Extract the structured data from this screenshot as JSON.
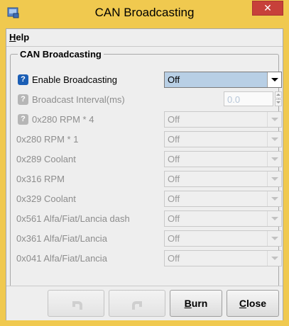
{
  "window": {
    "title": "CAN Broadcasting",
    "close_glyph": "✕",
    "app_icon": "app-icon",
    "accent_color": "#f0c94f",
    "close_color": "#c7403a"
  },
  "menu": {
    "help_mnemonic": "H",
    "help_rest": "elp"
  },
  "group": {
    "legend": "CAN Broadcasting"
  },
  "help_icon_glyph": "?",
  "settings": [
    {
      "label": "Enable Broadcasting",
      "value": "Off",
      "enabled": true,
      "help_icon": true
    },
    {
      "label": "Broadcast Interval(ms)",
      "value": "0.0",
      "enabled": false,
      "help_icon": true,
      "control": "spinner"
    },
    {
      "label": "0x280 RPM * 4",
      "value": "Off",
      "enabled": false,
      "help_icon": true
    },
    {
      "label": "0x280 RPM * 1",
      "value": "Off",
      "enabled": false,
      "help_icon": false
    },
    {
      "label": "0x289 Coolant",
      "value": "Off",
      "enabled": false,
      "help_icon": false
    },
    {
      "label": "0x316 RPM",
      "value": "Off",
      "enabled": false,
      "help_icon": false
    },
    {
      "label": "0x329 Coolant",
      "value": "Off",
      "enabled": false,
      "help_icon": false
    },
    {
      "label": "0x561 Alfa/Fiat/Lancia dash",
      "value": "Off",
      "enabled": false,
      "help_icon": false
    },
    {
      "label": "0x361 Alfa/Fiat/Lancia",
      "value": "Off",
      "enabled": false,
      "help_icon": false
    },
    {
      "label": "0x041 Alfa/Fiat/Lancia",
      "value": "Off",
      "enabled": false,
      "help_icon": false
    }
  ],
  "buttons": {
    "undo_icon": "undo-icon",
    "redo_icon": "redo-icon",
    "burn_mnemonic": "B",
    "burn_rest": "urn",
    "close_mnemonic": "C",
    "close_rest": "lose"
  }
}
